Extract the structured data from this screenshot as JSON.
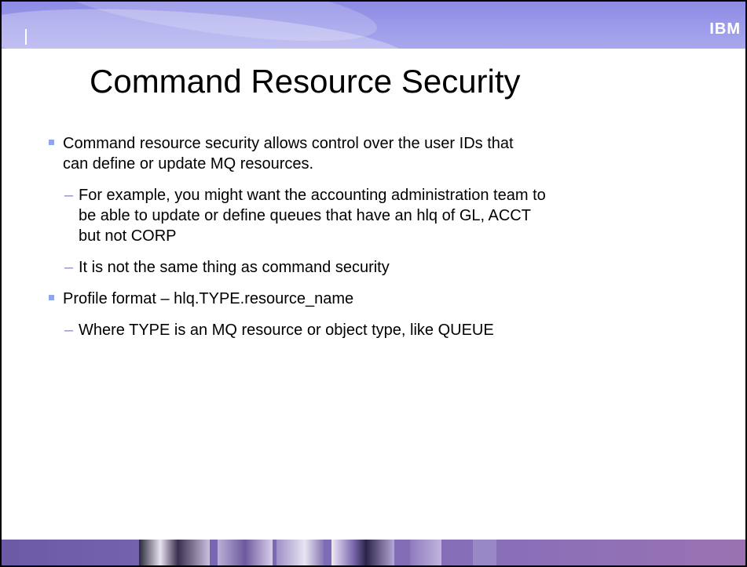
{
  "slide": {
    "title": "Command Resource Security",
    "logo_text": "IBM",
    "bullets": [
      {
        "text": "Command resource security allows control over the user IDs that can define or update MQ resources.",
        "sub": [
          "For example, you might want the accounting administration team to be able to update or define queues that have an hlq of GL, ACCT but not CORP",
          "It is not the same thing as command security"
        ]
      },
      {
        "text": "Profile format – hlq.TYPE.resource_name",
        "sub": [
          "Where TYPE is an MQ resource or object type, like QUEUE"
        ]
      }
    ],
    "sub_marker": "–"
  },
  "colors": {
    "banner": "#8d8be4",
    "bullet_square": "#8fa6e8",
    "dash": "#8b8de4",
    "footer": "#6c5aa6"
  }
}
